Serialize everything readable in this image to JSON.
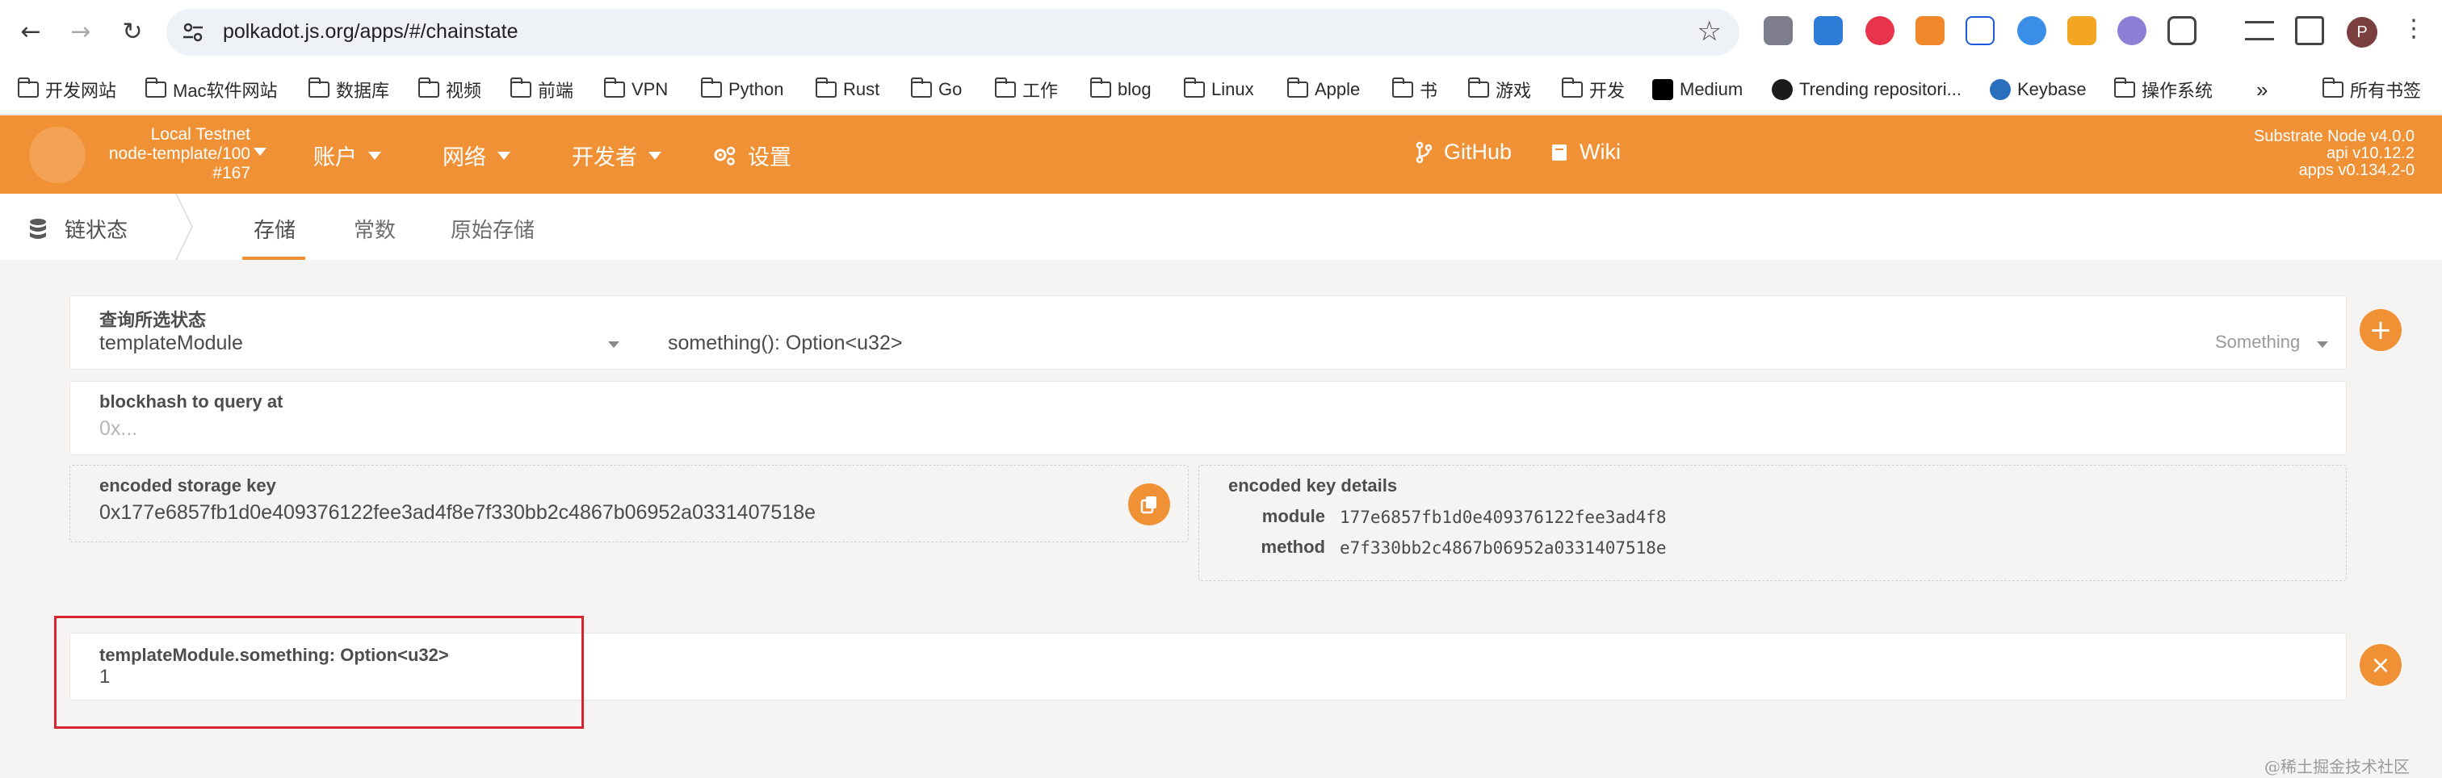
{
  "browser": {
    "url": "polkadot.js.org/apps/#/chainstate",
    "profile_initial": "P",
    "bookmarks": [
      "开发网站",
      "Mac软件网站",
      "数据库",
      "视频",
      "前端",
      "VPN",
      "Python",
      "Rust",
      "Go",
      "工作",
      "blog",
      "Linux",
      "Apple",
      "书",
      "游戏",
      "开发",
      "Medium",
      "Trending repositori...",
      "Keybase",
      "操作系统"
    ],
    "more_bookmarks": "»",
    "all_bookmarks": "所有书签"
  },
  "header": {
    "chain_name": "Local Testnet",
    "chain_node": "node-template/100",
    "chain_block": "#167",
    "menu": [
      "账户",
      "网络",
      "开发者",
      "设置"
    ],
    "links": [
      "GitHub",
      "Wiki"
    ],
    "version": [
      "Substrate Node v4.0.0",
      "api v10.12.2",
      "apps v0.134.2-0"
    ]
  },
  "subnav": {
    "section": "链状态",
    "tabs": [
      "存储",
      "常数",
      "原始存储"
    ],
    "active_tab": "存储"
  },
  "query": {
    "label": "查询所选状态",
    "module": "templateModule",
    "method": "something(): Option<u32>",
    "item": "Something"
  },
  "blockhash": {
    "label": "blockhash to query at",
    "placeholder": "0x..."
  },
  "encoded_key": {
    "label": "encoded storage key",
    "value": "0x177e6857fb1d0e409376122fee3ad4f8e7f330bb2c4867b06952a0331407518e"
  },
  "key_details": {
    "label": "encoded key details",
    "module_label": "module",
    "module_value": "177e6857fb1d0e409376122fee3ad4f8",
    "method_label": "method",
    "method_value": "e7f330bb2c4867b06952a0331407518e"
  },
  "result": {
    "label": "templateModule.something: Option<u32>",
    "value": "1"
  },
  "watermark": "@稀土掘金技术社区",
  "colors": {
    "accent": "#f19135",
    "highlight": "#d9232e"
  }
}
